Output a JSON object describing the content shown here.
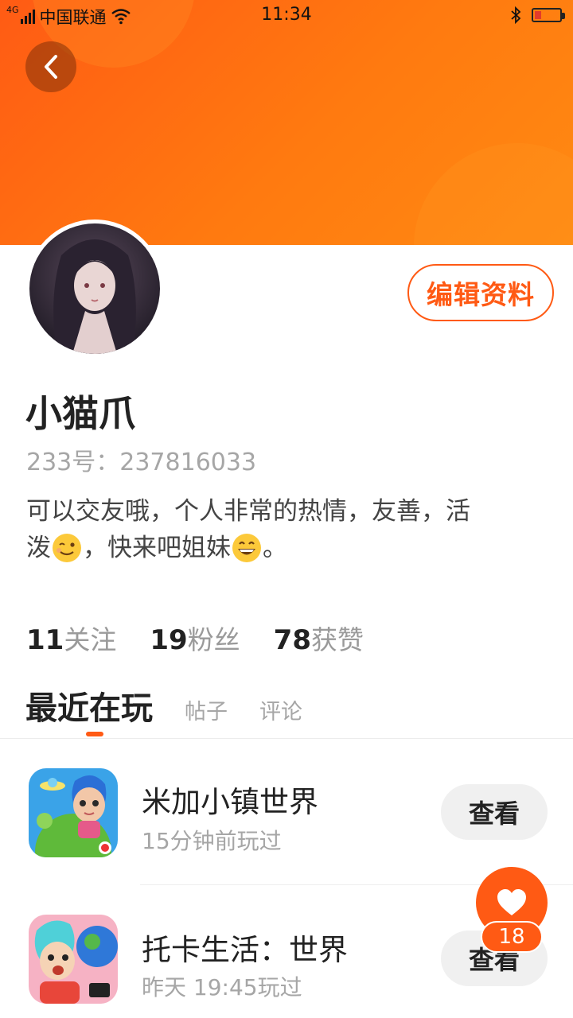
{
  "status_bar": {
    "network": "4G",
    "carrier": "中国联通",
    "time": "11:34"
  },
  "profile": {
    "edit_label": "编辑资料",
    "nickname": "小猫爪",
    "id_text": "233号：237816033",
    "bio_line1": "可以交友哦，个人非常的热情，友善，活",
    "bio_line2_a": "泼",
    "bio_line2_b": "，快来吧姐妹",
    "bio_line2_c": " 。"
  },
  "stats": [
    {
      "num": "11",
      "label": "关注"
    },
    {
      "num": "19",
      "label": "粉丝"
    },
    {
      "num": "78",
      "label": "获赞"
    }
  ],
  "tabs": {
    "active": "最近在玩",
    "posts": "帖子",
    "comments": "评论"
  },
  "games": [
    {
      "name": "米加小镇世界",
      "time": "15分钟前玩过",
      "button": "查看"
    },
    {
      "name": "托卡生活：世界",
      "time": "昨天 19:45玩过",
      "button": "查看"
    }
  ],
  "fab": {
    "count": "18"
  },
  "colors": {
    "accent": "#ff5a14",
    "banner": "#ff7a10"
  }
}
